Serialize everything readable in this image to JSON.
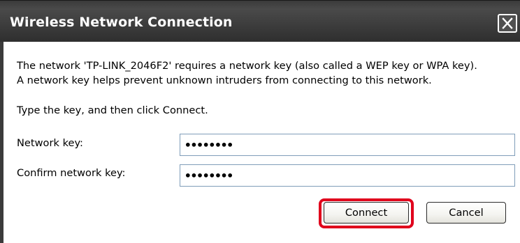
{
  "dialog": {
    "title": "Wireless Network Connection",
    "message_line1": "The network 'TP-LINK_2046F2' requires a network key (also called a WEP key or WPA key).",
    "message_line2": "A network key helps prevent unknown intruders from connecting to this network.",
    "instruction": "Type the key, and then click Connect.",
    "fields": {
      "network_key_label": "Network key:",
      "network_key_value": "••••••••",
      "confirm_key_label": "Confirm network key:",
      "confirm_key_value": "••••••••"
    },
    "buttons": {
      "connect": "Connect",
      "cancel": "Cancel"
    }
  },
  "colors": {
    "titlebar": "#3a3a3a",
    "highlight": "#e0001c",
    "field_border": "#7f9db9"
  },
  "icons": {
    "close": "close-icon"
  }
}
